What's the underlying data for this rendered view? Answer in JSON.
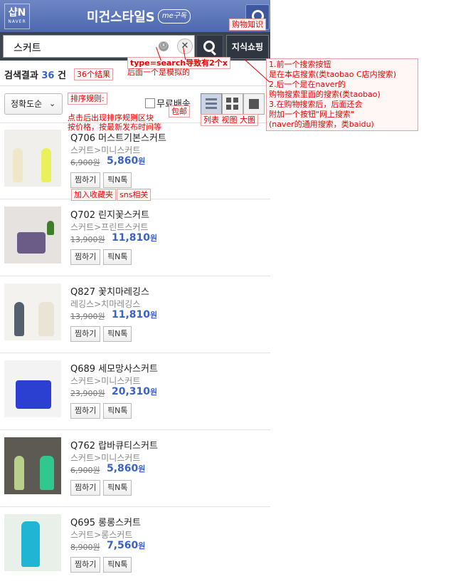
{
  "header": {
    "logo_main": "샵N",
    "logo_sub": "NAVER",
    "brand_title": "미건스타일S",
    "me_badge": "me구독"
  },
  "search": {
    "query": "스커트",
    "clear_icon": "ⓧ",
    "close_icon": "✕",
    "knowledge_button": "지식쇼핑"
  },
  "results": {
    "label": "검색결과",
    "count": "36",
    "unit": "건"
  },
  "filters": {
    "sort_label": "정확도순",
    "free_shipping_label": "무료배송",
    "view_modes": [
      "list",
      "grid",
      "big"
    ]
  },
  "items": [
    {
      "name": "Q706 머스트기본스커트",
      "category": "스커트>미니스커트",
      "old_price": "6,900원",
      "price_num": "5,860",
      "price_unit": "원",
      "btn_fav": "찜하기",
      "btn_pick": "픽N톡"
    },
    {
      "name": "Q702 린지꽃스커트",
      "category": "스커트>프린트스커트",
      "old_price": "13,900원",
      "price_num": "11,810",
      "price_unit": "원",
      "btn_fav": "찜하기",
      "btn_pick": "픽N톡"
    },
    {
      "name": "Q827 꽃치마레깅스",
      "category": "레깅스>치마레깅스",
      "old_price": "13,900원",
      "price_num": "11,810",
      "price_unit": "원",
      "btn_fav": "찜하기",
      "btn_pick": "픽N톡"
    },
    {
      "name": "Q689 세모망사스커트",
      "category": "스커트>미니스커트",
      "old_price": "23,900원",
      "price_num": "20,310",
      "price_unit": "원",
      "btn_fav": "찜하기",
      "btn_pick": "픽N톡"
    },
    {
      "name": "Q762 랍바큐티스커트",
      "category": "스커트>미니스커트",
      "old_price": "6,900원",
      "price_num": "5,860",
      "price_unit": "원",
      "btn_fav": "찜하기",
      "btn_pick": "픽N톡"
    },
    {
      "name": "Q695 롱롱스커트",
      "category": "스커트>롱스커트",
      "old_price": "8,900원",
      "price_num": "7,560",
      "price_unit": "원",
      "btn_fav": "찜하기",
      "btn_pick": "픽N톡"
    }
  ],
  "annotations": {
    "shopping_knowledge": "购物知识",
    "type_search": "type=search导致有2个x",
    "fake_note": "后面一个是模拟的",
    "count_note": "36个结果",
    "sort_rule": "排序规则:",
    "sort_detail_1": "点击后出现排序规则区块",
    "sort_detail_2": "按价格，按最新发布时间等",
    "free_ship": "包邮",
    "views": "列表  视图  大图",
    "fav_note": "加入收藏夹",
    "sns_note": "sns相关",
    "search_note_1": "1.前一个搜索按钮",
    "search_note_2": "是在本店搜索(类taobao C店内搜索)",
    "search_note_3": "2.后一个是在naver的",
    "search_note_4": "购物搜索里面的搜索(类taobao)",
    "search_note_5": "3.在购物搜索后，后面还会",
    "search_note_6": "附加一个按钮\"网上搜索\"",
    "search_note_7": "(naver的通用搜索，类baidu)"
  },
  "colors": {
    "header_blue": "#5a73b8",
    "search_bar": "#3b4250",
    "price_blue": "#3a62c6",
    "annotation_red": "#ee0000"
  }
}
